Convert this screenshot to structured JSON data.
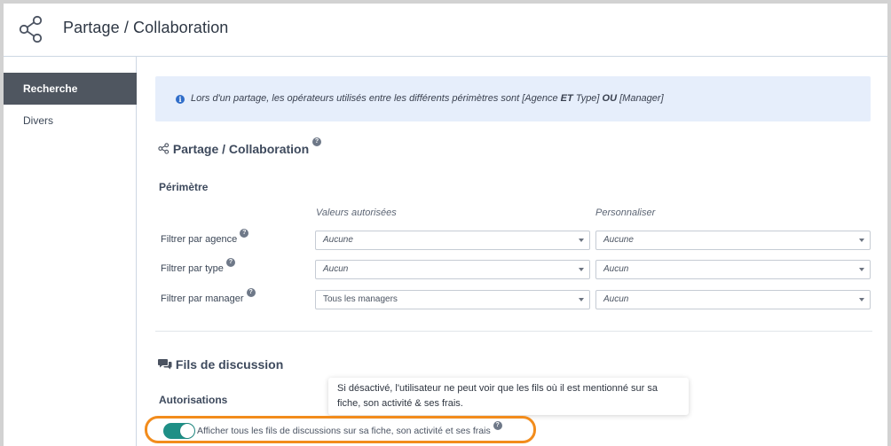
{
  "header": {
    "title": "Partage / Collaboration",
    "icon": "share-icon"
  },
  "sidebar": {
    "items": [
      {
        "label": "Recherche",
        "active": true
      },
      {
        "label": "Divers",
        "active": false
      }
    ]
  },
  "info": {
    "text_before": "Lors d'un partage, les opérateurs utilisés entre les différents périmètres sont [Agence ",
    "bold_1": "ET",
    "text_middle": " Type] ",
    "bold_2": "OU",
    "text_after": " [Manager]"
  },
  "share_section": {
    "title": "Partage / Collaboration",
    "subsection": "Périmètre",
    "col_allowed": "Valeurs autorisées",
    "col_custom": "Personnaliser",
    "rows": [
      {
        "label": "Filtrer par agence",
        "allowed": "Aucune",
        "custom": "Aucune"
      },
      {
        "label": "Filtrer par type",
        "allowed": "Aucun",
        "custom": "Aucun"
      },
      {
        "label": "Filtrer par manager",
        "allowed": "Tous les managers",
        "custom": "Aucun"
      }
    ]
  },
  "threads_section": {
    "title": "Fils de discussion",
    "subsection": "Autorisations",
    "tooltip": "Si désactivé, l'utilisateur ne peut voir que les fils où il est mentionné sur sa fiche, son activité & ses frais.",
    "toggle_label": "Afficher tous les fils de discussions sur sa fiche, son activité et ses frais",
    "toggle_on": true
  },
  "help_glyph": "?",
  "info_glyph": "i",
  "colors": {
    "accent": "#1e8f86",
    "highlight": "#f28c1c",
    "sidebar_active": "#4f5660",
    "info_bg": "#e6eefb"
  }
}
